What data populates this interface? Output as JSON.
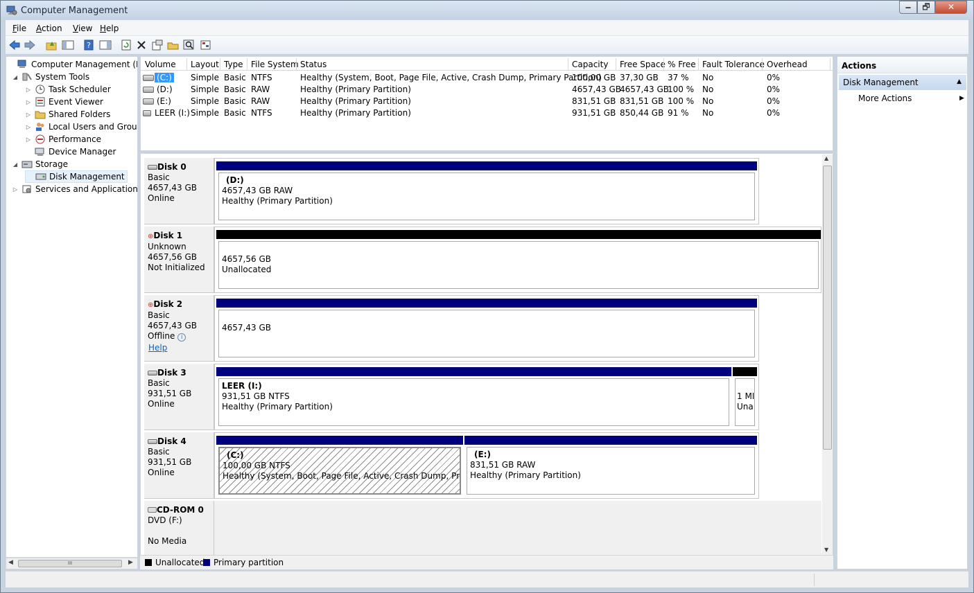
{
  "window": {
    "title": "Computer Management",
    "minimize": "🗕",
    "maximize": "🗗",
    "close": "✕"
  },
  "menu": [
    "File",
    "Action",
    "View",
    "Help"
  ],
  "menu_underline": [
    "F",
    "A",
    "V",
    "H"
  ],
  "toolbar": {
    "icons": [
      "back-arrow-icon",
      "forward-arrow-icon",
      "up-folder-icon",
      "show-hide-console-tree-icon",
      "help-icon",
      "show-hide-action-pane-icon",
      "refresh-icon",
      "delete-icon",
      "properties-icon",
      "open-icon",
      "search-icon",
      "settings-icon"
    ]
  },
  "tree": {
    "items": [
      {
        "label": "Computer Management (Local",
        "level": 0,
        "expander": ""
      },
      {
        "label": "System Tools",
        "level": 1,
        "expander": "◢"
      },
      {
        "label": "Task Scheduler",
        "level": 2,
        "expander": "▷"
      },
      {
        "label": "Event Viewer",
        "level": 2,
        "expander": "▷"
      },
      {
        "label": "Shared Folders",
        "level": 2,
        "expander": "▷"
      },
      {
        "label": "Local Users and Groups",
        "level": 2,
        "expander": "▷"
      },
      {
        "label": "Performance",
        "level": 2,
        "expander": "▷"
      },
      {
        "label": "Device Manager",
        "level": 2,
        "expander": ""
      },
      {
        "label": "Storage",
        "level": 1,
        "expander": "◢"
      },
      {
        "label": "Disk Management",
        "level": 2,
        "expander": "",
        "selected": true
      },
      {
        "label": "Services and Applications",
        "level": 1,
        "expander": "▷"
      }
    ],
    "scroll_thumb": "III"
  },
  "volume_list": {
    "columns": [
      "Volume",
      "Layout",
      "Type",
      "File System",
      "Status",
      "Capacity",
      "Free Space",
      "% Free",
      "Fault Tolerance",
      "Overhead"
    ],
    "rows": [
      [
        "(C:)",
        "Simple",
        "Basic",
        "NTFS",
        "Healthy (System, Boot, Page File, Active, Crash Dump, Primary Partition)",
        "100,00 GB",
        "37,30 GB",
        "37 %",
        "No",
        "0%"
      ],
      [
        "(D:)",
        "Simple",
        "Basic",
        "RAW",
        "Healthy (Primary Partition)",
        "4657,43 GB",
        "4657,43 GB",
        "100 %",
        "No",
        "0%"
      ],
      [
        "(E:)",
        "Simple",
        "Basic",
        "RAW",
        "Healthy (Primary Partition)",
        "831,51 GB",
        "831,51 GB",
        "100 %",
        "No",
        "0%"
      ],
      [
        "LEER (I:)",
        "Simple",
        "Basic",
        "NTFS",
        "Healthy (Primary Partition)",
        "931,51 GB",
        "850,44 GB",
        "91 %",
        "No",
        "0%"
      ]
    ]
  },
  "disks": [
    {
      "name": "Disk 0",
      "line1": "Basic",
      "line2": "4657,43 GB",
      "line3": "Online",
      "link": "",
      "partitions": [
        {
          "title": "(D:)",
          "size": "4657,43 GB RAW",
          "status": "Healthy (Primary Partition)",
          "kind": "primary"
        }
      ]
    },
    {
      "name": "Disk 1",
      "line1": "Unknown",
      "line2": "4657,56 GB",
      "line3": "Not Initialized",
      "link": "",
      "partitions": [
        {
          "title": "",
          "size": "4657,56 GB",
          "status": "Unallocated",
          "kind": "unallocated"
        }
      ]
    },
    {
      "name": "Disk 2",
      "line1": "Basic",
      "line2": "4657,43 GB",
      "line3": "Offline",
      "link": "Help",
      "partitions": [
        {
          "title": "",
          "size": "4657,43 GB",
          "status": "",
          "kind": "primary"
        }
      ]
    },
    {
      "name": "Disk 3",
      "line1": "Basic",
      "line2": "931,51 GB",
      "line3": "Online",
      "link": "",
      "partitions": [
        {
          "title": "LEER  (I:)",
          "size": "931,51 GB NTFS",
          "status": "Healthy (Primary Partition)",
          "kind": "primary"
        },
        {
          "title": "",
          "size": "1 MI",
          "status": "Una",
          "kind": "unallocated"
        }
      ]
    },
    {
      "name": "Disk 4",
      "line1": "Basic",
      "line2": "931,51 GB",
      "line3": "Online",
      "link": "",
      "partitions": [
        {
          "title": "(C:)",
          "size": "100,00 GB NTFS",
          "status": "Healthy (System, Boot, Page File, Active, Crash Dump, Primary Pa",
          "kind": "primary"
        },
        {
          "title": "(E:)",
          "size": "831,51 GB RAW",
          "status": "Healthy (Primary Partition)",
          "kind": "primary"
        }
      ]
    },
    {
      "name": "CD-ROM 0",
      "line1": "DVD (F:)",
      "line2": "",
      "line3": "No Media",
      "link": "",
      "partitions": []
    }
  ],
  "legend": [
    {
      "label": "Unallocated",
      "color": "#000000"
    },
    {
      "label": "Primary partition",
      "color": "#00007f"
    }
  ],
  "actions": {
    "header": "Actions",
    "section": "Disk Management",
    "items": [
      "More Actions"
    ]
  },
  "colors": {
    "primary": "#00007f",
    "unallocated": "#000000",
    "selection": "#cde8ff"
  }
}
